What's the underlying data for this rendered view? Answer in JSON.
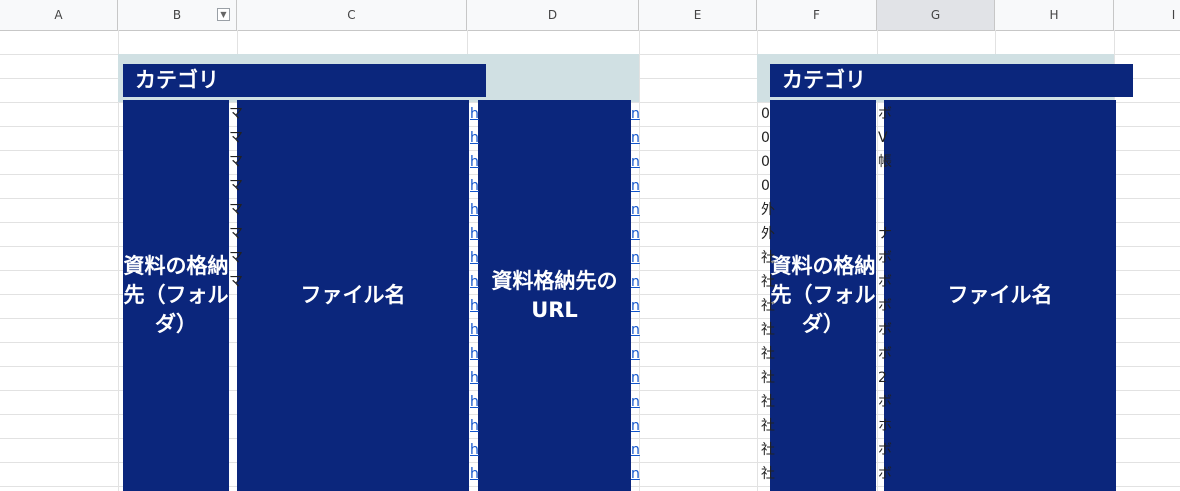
{
  "columns": [
    "A",
    "B",
    "C",
    "D",
    "E",
    "F",
    "G",
    "H",
    "I"
  ],
  "left_block": {
    "category": "カテゴリ",
    "folder_header": "資料の格納先（フォルダ）",
    "filename_header": "ファイル名",
    "url_header": "資料格納先のURL"
  },
  "right_block": {
    "category": "カテゴリ",
    "folder_header": "資料の格納先（フォルダ）",
    "filename_header": "ファイル名"
  },
  "left_fragments": {
    "col_b_mid": [
      "マ",
      "マ",
      "マ",
      "マ",
      "マ",
      "マ",
      "マ",
      "マ"
    ],
    "col_d_left": [
      "h",
      "h",
      "h",
      "h",
      "h",
      "h",
      "h",
      "h",
      "h",
      "h",
      "h",
      "h",
      "h",
      "h",
      "h",
      "h"
    ],
    "col_d_right": [
      "n",
      "n",
      "n",
      "n",
      "n",
      "n",
      "n",
      "n",
      "n",
      "n",
      "n",
      "n",
      "n",
      "n",
      "n",
      "n"
    ]
  },
  "right_fragments": {
    "col_f_left": [
      "0",
      "0",
      "0",
      "0",
      "外",
      "外",
      "社",
      "社",
      "社",
      "社",
      "社",
      "社",
      "社",
      "社",
      "社",
      "社"
    ],
    "col_g_left": [
      "ボ",
      "V",
      "帳",
      "",
      "",
      "ナ",
      "ボ",
      "ボ",
      "ボ",
      "ボ",
      "ボ",
      "2",
      "ボ",
      "ホ",
      "ボ",
      "ボ"
    ]
  },
  "colors": {
    "navy": "#0b267c",
    "header_tint": "#d0e0e3",
    "link": "#1155cc"
  }
}
